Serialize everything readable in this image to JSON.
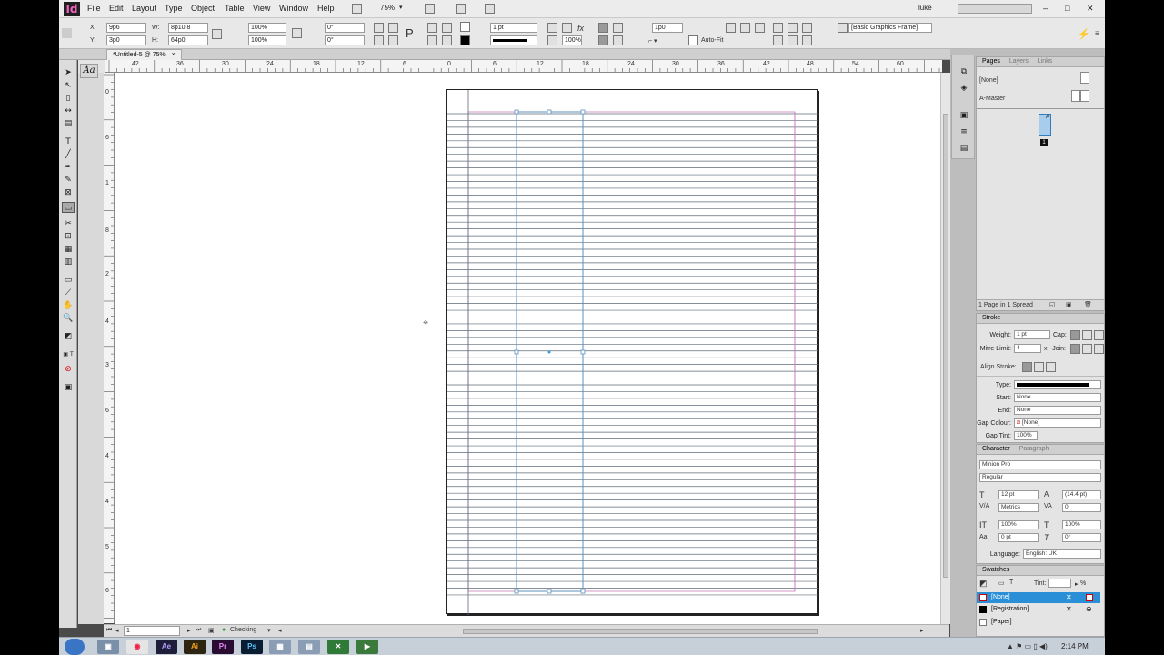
{
  "app": {
    "logo": "Id",
    "user": "luke"
  },
  "menu": [
    "File",
    "Edit",
    "Layout",
    "Type",
    "Object",
    "Table",
    "View",
    "Window",
    "Help"
  ],
  "zoom": "75%",
  "control": {
    "x": "9p6",
    "y": "3p0",
    "w": "8p10.8",
    "h": "64p0",
    "scale_x": "100%",
    "scale_y": "100%",
    "rotate": "0°",
    "shear": "0°",
    "stroke_weight": "1 pt",
    "fill_pct": "100%",
    "offset": "1p0",
    "autofit": "Auto-Fit",
    "frame_style": "[Basic Graphics Frame]"
  },
  "doc_tab": "*Untitled-5 @ 75%",
  "ruler_top": [
    "42",
    "36",
    "30",
    "24",
    "18",
    "12",
    "6",
    "0",
    "6",
    "12",
    "18",
    "24",
    "30",
    "36",
    "42",
    "48",
    "54",
    "60"
  ],
  "ruler_left": [
    "0",
    "6",
    "1",
    "8",
    "2",
    "4",
    "3",
    "0",
    "3",
    "6",
    "4",
    "2",
    "4",
    "8",
    "5",
    "4",
    "6"
  ],
  "status": {
    "page": "1",
    "preflight": "Checking"
  },
  "pages_panel": {
    "tabs": [
      "Pages",
      "Layers",
      "Links"
    ],
    "none_label": "[None]",
    "master_label": "A-Master",
    "thumb_letter": "A",
    "page_num": "1",
    "footer": "1 Page in 1 Spread"
  },
  "stroke_panel": {
    "title": "Stroke",
    "weight_label": "Weight:",
    "weight": "1 pt",
    "cap_label": "Cap:",
    "mitre_label": "Mitre Limit:",
    "mitre": "4",
    "mitre_x": "x",
    "join_label": "Join:",
    "align_label": "Align Stroke:",
    "type_label": "Type:",
    "start_label": "Start:",
    "start": "None",
    "end_label": "End:",
    "end": "None",
    "gap_colour_label": "Gap Colour:",
    "gap_colour": "[None]",
    "gap_tint_label": "Gap Tint:",
    "gap_tint": "100%"
  },
  "character_panel": {
    "tabs": [
      "Character",
      "Paragraph"
    ],
    "font": "Minion Pro",
    "style": "Regular",
    "size": "12 pt",
    "leading": "(14.4 pt)",
    "kerning": "Metrics",
    "tracking": "0",
    "vscale": "100%",
    "hscale": "100%",
    "baseline": "0 pt",
    "skew": "0°",
    "language_label": "Language:",
    "language": "English: UK"
  },
  "swatches_panel": {
    "title": "Swatches",
    "tint_label": "Tint:",
    "tint_pct": "%",
    "items": [
      "[None]",
      "[Registration]",
      "[Paper]"
    ]
  },
  "taskbar": {
    "time": "2:14 PM",
    "apps": [
      "Ae",
      "Ai",
      "Pr",
      "Ps"
    ]
  },
  "colors": {
    "selection_blue": "#2f9ad8",
    "guide_magenta": "#c77ab8",
    "frame_blue": "#5b8fbf"
  }
}
